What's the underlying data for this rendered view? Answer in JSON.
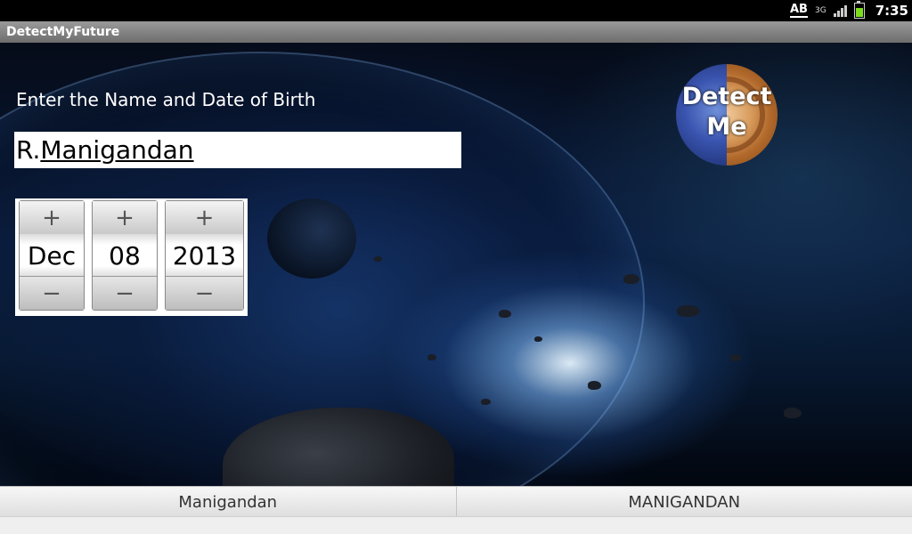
{
  "status_bar": {
    "ab_label": "AB",
    "network_label": "3G",
    "time": "7:35"
  },
  "app": {
    "title": "DetectMyFuture"
  },
  "form": {
    "prompt": "Enter the Name and Date of Birth",
    "name_prefix": "R.",
    "name_underlined": "Manigandan",
    "date": {
      "month": "Dec",
      "day": "08",
      "year": "2013"
    },
    "plus_symbol": "+",
    "minus_symbol": "−",
    "detect_button_label": "Detect Me"
  },
  "tabs": [
    {
      "label": "Manigandan"
    },
    {
      "label": "MANIGANDAN"
    }
  ]
}
